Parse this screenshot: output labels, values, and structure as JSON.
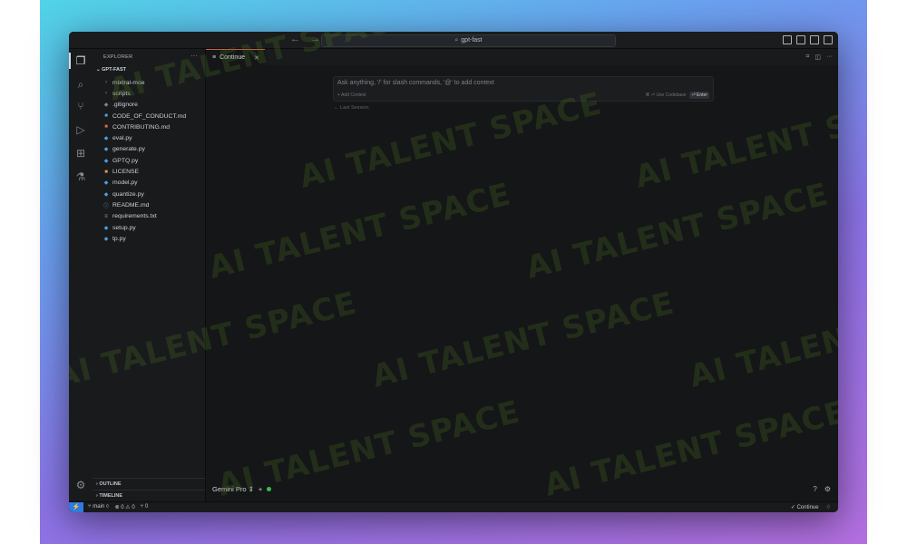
{
  "titlebar": {
    "search_text": "gpt-fast",
    "nav_back": "←",
    "nav_forward": "→"
  },
  "sidebar": {
    "title": "EXPLORER",
    "more": "···",
    "folder": "GPT-FAST",
    "items": [
      {
        "label": "mixtral-moe",
        "icon": "chevron-right",
        "color": "#8a8f95"
      },
      {
        "label": "scripts",
        "icon": "chevron-right",
        "color": "#8a8f95"
      },
      {
        "label": ".gitignore",
        "icon": "gear",
        "color": "#7c8288"
      },
      {
        "label": "CODE_OF_CONDUCT.md",
        "icon": "markdown",
        "color": "#5aa0e6"
      },
      {
        "label": "CONTRIBUTING.md",
        "icon": "markdown-red",
        "color": "#e06c4a"
      },
      {
        "label": "eval.py",
        "icon": "python",
        "color": "#4a9ee0"
      },
      {
        "label": "generate.py",
        "icon": "python",
        "color": "#4a9ee0"
      },
      {
        "label": "GPTQ.py",
        "icon": "python",
        "color": "#4a9ee0"
      },
      {
        "label": "LICENSE",
        "icon": "license",
        "color": "#d6a640"
      },
      {
        "label": "model.py",
        "icon": "python",
        "color": "#4a9ee0"
      },
      {
        "label": "quantize.py",
        "icon": "python",
        "color": "#4a9ee0"
      },
      {
        "label": "README.md",
        "icon": "info",
        "color": "#5aa0e6"
      },
      {
        "label": "requirements.txt",
        "icon": "lines",
        "color": "#9aa0a6"
      },
      {
        "label": "setup.py",
        "icon": "python",
        "color": "#4a9ee0"
      },
      {
        "label": "tp.py",
        "icon": "python",
        "color": "#4a9ee0"
      }
    ],
    "outline": "OUTLINE",
    "timeline": "TIMELINE"
  },
  "editor": {
    "tab_label": "Continue",
    "input_placeholder": "Ask anything, '/' for slash commands, '@' to add context",
    "add_context": "+ Add Context",
    "use_codebase": "⌘ ⏎ Use Codebase",
    "enter": "⏎ Enter",
    "last_session": "← Last Session",
    "model": "Gemini Pro",
    "add": "+"
  },
  "statusbar": {
    "branch": "main",
    "problems": "⊗ 0 ⚠ 0",
    "ports": "⑂ 0",
    "continue": "✓ Continue"
  },
  "watermark": "AI TALENT SPACE"
}
